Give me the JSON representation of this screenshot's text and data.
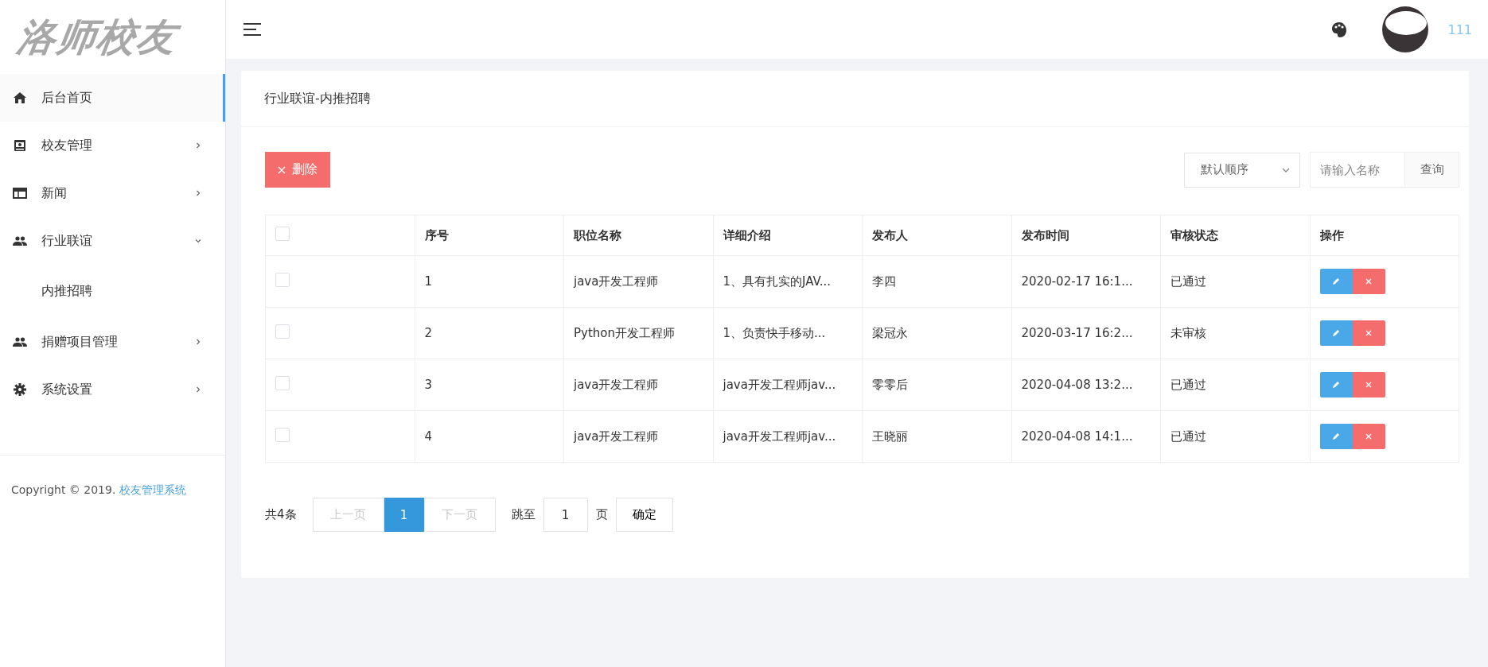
{
  "sidebar": {
    "logo": "洛师校友",
    "items": [
      {
        "label": "后台首页",
        "kind": "link",
        "selected": true
      },
      {
        "label": "校友管理",
        "kind": "group",
        "expanded": false,
        "selected": false
      },
      {
        "label": "新闻",
        "kind": "group",
        "expanded": false,
        "selected": false
      },
      {
        "label": "行业联谊",
        "kind": "group",
        "expanded": true,
        "selected": false,
        "children": [
          {
            "label": "内推招聘",
            "selected": false
          }
        ]
      },
      {
        "label": "捐赠项目管理",
        "kind": "group",
        "expanded": false,
        "selected": false
      },
      {
        "label": "系统设置",
        "kind": "group",
        "expanded": false,
        "selected": false
      }
    ],
    "copyright": "Copyright © 2019.",
    "copyright_link": "校友管理系统"
  },
  "header": {
    "username": "111"
  },
  "page": {
    "title": "行业联谊-内推招聘",
    "delete_button": "删除",
    "sort_select": "默认顺序",
    "search": {
      "placeholder": "请输入名称"
    },
    "search_button": "查询",
    "table": {
      "columns": [
        "序号",
        "职位名称",
        "详细介绍",
        "发布人",
        "发布时间",
        "审核状态",
        "操作"
      ],
      "header_checked": false,
      "rows": [
        {
          "checked": false,
          "cells": [
            "1",
            "java开发工程师",
            "1、具有扎实的JAV...",
            "李四",
            "2020-02-17 16:1...",
            "已通过"
          ]
        },
        {
          "checked": false,
          "cells": [
            "2",
            "Python开发工程师",
            "1、负责快手移动...",
            "梁冠永",
            "2020-03-17 16:2...",
            "未审核"
          ]
        },
        {
          "checked": false,
          "cells": [
            "3",
            "java开发工程师",
            "java开发工程师jav...",
            "零零后",
            "2020-04-08 13:2...",
            "已通过"
          ]
        },
        {
          "checked": false,
          "cells": [
            "4",
            "java开发工程师",
            "java开发工程师jav...",
            "王晓丽",
            "2020-04-08 14:1...",
            "已通过"
          ]
        }
      ]
    },
    "pagination": {
      "total": "共4条",
      "prev": "上一页",
      "prev_disabled": true,
      "pages": [
        {
          "label": "1",
          "selected": true
        }
      ],
      "next": "下一页",
      "next_disabled": true,
      "jump_label": "跳至",
      "jump_value": "1",
      "page_unit": "页",
      "confirm": "确定"
    }
  }
}
